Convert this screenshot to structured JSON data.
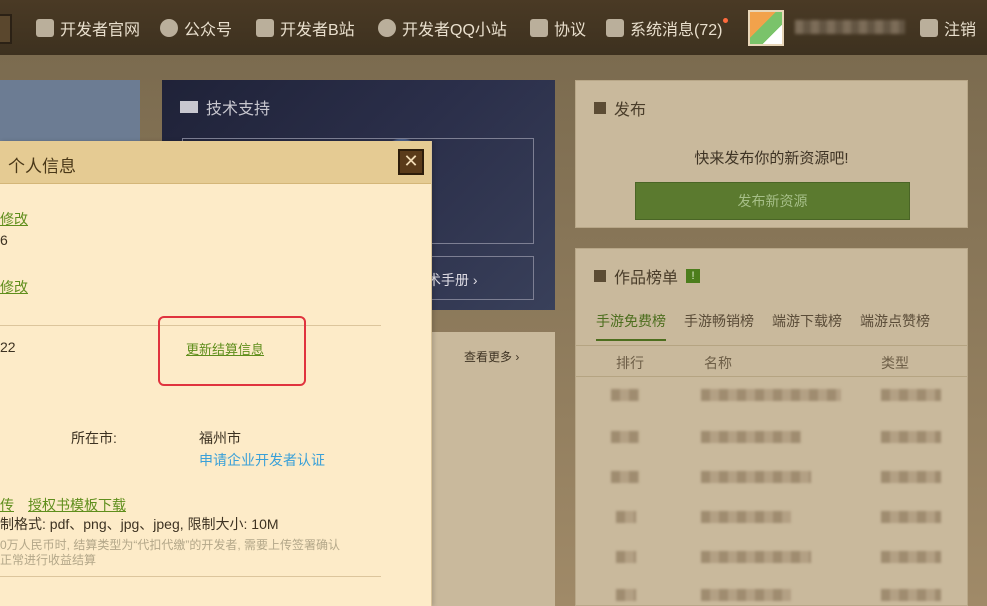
{
  "nav": {
    "items": [
      {
        "label": "开发者官网",
        "icon": "home-icon"
      },
      {
        "label": "公众号",
        "icon": "wechat-icon"
      },
      {
        "label": "开发者B站",
        "icon": "bilibili-icon"
      },
      {
        "label": "开发者QQ小站",
        "icon": "qq-icon"
      },
      {
        "label": "协议",
        "icon": "document-icon"
      },
      {
        "label": "系统消息(72)",
        "icon": "bell-icon"
      }
    ],
    "logout_label": "注销"
  },
  "tech_support": {
    "title": "技术支持",
    "manual_link": "术手册 ›"
  },
  "publish": {
    "title": "发布",
    "hint": "快来发布你的新资源吧!",
    "button": "发布新资源"
  },
  "rank": {
    "title": "作品榜单",
    "badge": "!",
    "tabs": [
      "手游免费榜",
      "手游畅销榜",
      "端游下载榜",
      "端游点赞榜"
    ],
    "columns": [
      "排行",
      "名称",
      "类型"
    ]
  },
  "news": {
    "more_link": "查看更多 ›"
  },
  "modal": {
    "title": "个人信息",
    "close_symbol": "✕",
    "edit_link_1": "修改",
    "value_1": "6",
    "edit_link_2": "修改",
    "value_3": "22",
    "update_settlement": "更新结算信息",
    "city_label": "所在市:",
    "city_value": "福州市",
    "enterprise_link": "申请企业开发者认证",
    "upload_link": "传",
    "template_link": "授权书模板下载",
    "format_text": "制格式: pdf、png、jpg、jpeg, 限制大小: 10M",
    "note_line_1": "0万人民币时, 结算类型为“代扣代缴”的开发者, 需要上传签署确认",
    "note_line_2": "正常进行收益结算"
  }
}
